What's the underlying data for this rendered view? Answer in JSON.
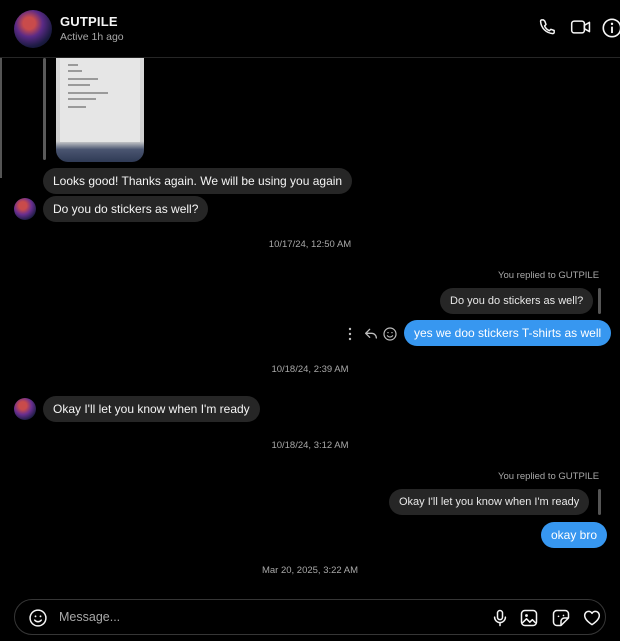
{
  "header": {
    "title": "GUTPILE",
    "status": "Active 1h ago",
    "icons": [
      "phone-icon",
      "video-icon",
      "info-icon"
    ]
  },
  "messages": {
    "m1": "Looks good! Thanks again. We will be using you again",
    "m2": "Do you do stickers as well?",
    "ts1": "10/17/24, 12:50 AM",
    "reply1_label": "You replied to GUTPILE",
    "reply1_quote": "Do you do stickers as well?",
    "m3": "yes we doo stickers T-shirts as well",
    "ts2": "10/18/24, 2:39 AM",
    "m4": "Okay I'll let you know when I'm ready",
    "ts3": "10/18/24, 3:12 AM",
    "reply2_label": "You replied to GUTPILE",
    "reply2_quote": "Okay I'll let you know when I'm ready",
    "m5": "okay bro",
    "ts4": "Mar 20, 2025, 3:22 AM"
  },
  "composer": {
    "placeholder": "Message...",
    "icons": [
      "emoji-icon",
      "microphone-icon",
      "image-icon",
      "sticker-icon",
      "heart-icon"
    ]
  },
  "colors": {
    "outgoing": "#3797f0",
    "incoming": "#262626",
    "background": "#000000"
  }
}
